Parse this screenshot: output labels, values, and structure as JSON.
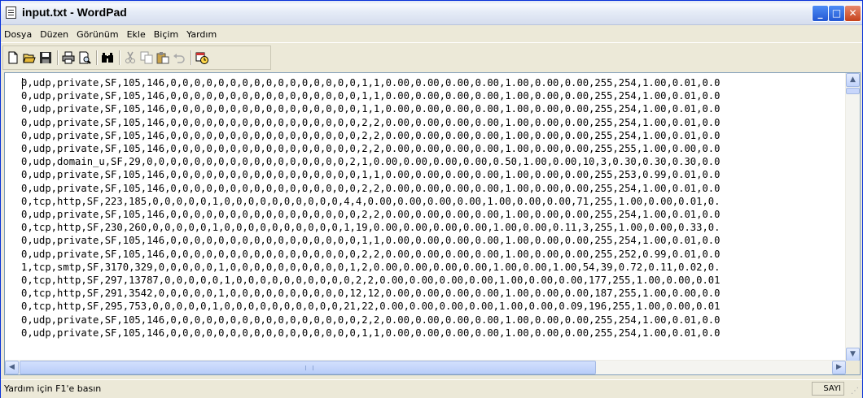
{
  "window": {
    "title": "input.txt - WordPad"
  },
  "menu": [
    "Dosya",
    "Düzen",
    "Görünüm",
    "Ekle",
    "Biçim",
    "Yardım"
  ],
  "toolbar": {
    "icons": [
      "new-document-icon",
      "open-folder-icon",
      "save-icon",
      "print-icon",
      "print-preview-icon",
      "find-icon",
      "cut-icon",
      "copy-icon",
      "paste-icon",
      "undo-icon",
      "insert-datetime-icon"
    ]
  },
  "document": {
    "lines": [
      "0,udp,private,SF,105,146,0,0,0,0,0,0,0,0,0,0,0,0,0,0,0,0,1,1,0.00,0.00,0.00,0.00,1.00,0.00,0.00,255,254,1.00,0.01,0.0",
      "0,udp,private,SF,105,146,0,0,0,0,0,0,0,0,0,0,0,0,0,0,0,0,1,1,0.00,0.00,0.00,0.00,1.00,0.00,0.00,255,254,1.00,0.01,0.0",
      "0,udp,private,SF,105,146,0,0,0,0,0,0,0,0,0,0,0,0,0,0,0,0,1,1,0.00,0.00,0.00,0.00,1.00,0.00,0.00,255,254,1.00,0.01,0.0",
      "0,udp,private,SF,105,146,0,0,0,0,0,0,0,0,0,0,0,0,0,0,0,0,2,2,0.00,0.00,0.00,0.00,1.00,0.00,0.00,255,254,1.00,0.01,0.0",
      "0,udp,private,SF,105,146,0,0,0,0,0,0,0,0,0,0,0,0,0,0,0,0,2,2,0.00,0.00,0.00,0.00,1.00,0.00,0.00,255,254,1.00,0.01,0.0",
      "0,udp,private,SF,105,146,0,0,0,0,0,0,0,0,0,0,0,0,0,0,0,0,2,2,0.00,0.00,0.00,0.00,1.00,0.00,0.00,255,255,1.00,0.00,0.0",
      "0,udp,domain_u,SF,29,0,0,0,0,0,0,0,0,0,0,0,0,0,0,0,0,0,2,1,0.00,0.00,0.00,0.00,0.50,1.00,0.00,10,3,0.30,0.30,0.30,0.0",
      "0,udp,private,SF,105,146,0,0,0,0,0,0,0,0,0,0,0,0,0,0,0,0,1,1,0.00,0.00,0.00,0.00,1.00,0.00,0.00,255,253,0.99,0.01,0.0",
      "0,udp,private,SF,105,146,0,0,0,0,0,0,0,0,0,0,0,0,0,0,0,0,2,2,0.00,0.00,0.00,0.00,1.00,0.00,0.00,255,254,1.00,0.01,0.0",
      "0,tcp,http,SF,223,185,0,0,0,0,0,1,0,0,0,0,0,0,0,0,0,0,4,4,0.00,0.00,0.00,0.00,1.00,0.00,0.00,71,255,1.00,0.00,0.01,0.",
      "0,udp,private,SF,105,146,0,0,0,0,0,0,0,0,0,0,0,0,0,0,0,0,2,2,0.00,0.00,0.00,0.00,1.00,0.00,0.00,255,254,1.00,0.01,0.0",
      "0,tcp,http,SF,230,260,0,0,0,0,0,1,0,0,0,0,0,0,0,0,0,0,1,19,0.00,0.00,0.00,0.00,1.00,0.00,0.11,3,255,1.00,0.00,0.33,0.",
      "0,udp,private,SF,105,146,0,0,0,0,0,0,0,0,0,0,0,0,0,0,0,0,1,1,0.00,0.00,0.00,0.00,1.00,0.00,0.00,255,254,1.00,0.01,0.0",
      "0,udp,private,SF,105,146,0,0,0,0,0,0,0,0,0,0,0,0,0,0,0,0,2,2,0.00,0.00,0.00,0.00,1.00,0.00,0.00,255,252,0.99,0.01,0.0",
      "1,tcp,smtp,SF,3170,329,0,0,0,0,0,1,0,0,0,0,0,0,0,0,0,0,1,2,0.00,0.00,0.00,0.00,1.00,0.00,1.00,54,39,0.72,0.11,0.02,0.",
      "0,tcp,http,SF,297,13787,0,0,0,0,0,1,0,0,0,0,0,0,0,0,0,0,2,2,0.00,0.00,0.00,0.00,1.00,0.00,0.00,177,255,1.00,0.00,0.01",
      "0,tcp,http,SF,291,3542,0,0,0,0,0,1,0,0,0,0,0,0,0,0,0,0,12,12,0.00,0.00,0.00,0.00,1.00,0.00,0.00,187,255,1.00,0.00,0.0",
      "0,tcp,http,SF,295,753,0,0,0,0,0,1,0,0,0,0,0,0,0,0,0,0,21,22,0.00,0.00,0.00,0.00,1.00,0.00,0.09,196,255,1.00,0.00,0.01",
      "0,udp,private,SF,105,146,0,0,0,0,0,0,0,0,0,0,0,0,0,0,0,0,2,2,0.00,0.00,0.00,0.00,1.00,0.00,0.00,255,254,1.00,0.01,0.0",
      "0,udp,private,SF,105,146,0,0,0,0,0,0,0,0,0,0,0,0,0,0,0,0,1,1,0.00,0.00,0.00,0.00,1.00,0.00,0.00,255,254,1.00,0.01,0.0"
    ]
  },
  "statusbar": {
    "help": "Yardım için F1'e basın",
    "mode": "SAYI"
  },
  "colors": {
    "titlebar": "#e6ecf7",
    "chrome": "#ece9d8",
    "close": "#c6421c",
    "minmax": "#2458d3"
  }
}
